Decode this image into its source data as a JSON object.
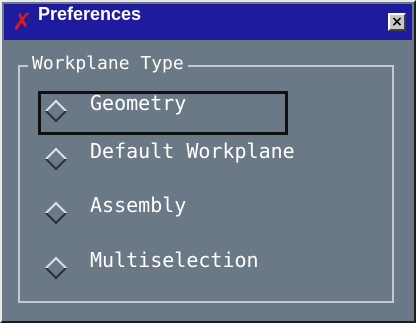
{
  "window": {
    "title": "Preferences",
    "app_icon": "x-mark-icon",
    "close_label": "×"
  },
  "group": {
    "label": "Workplane Type",
    "options": [
      {
        "label": "Geometry",
        "focused": true
      },
      {
        "label": "Default Workplane",
        "focused": false
      },
      {
        "label": "Assembly",
        "focused": false
      },
      {
        "label": "Multiselection",
        "focused": false
      }
    ]
  },
  "colors": {
    "titlebar": "#1f1b9e",
    "background": "#6b7885",
    "app_icon": "#e01818"
  }
}
